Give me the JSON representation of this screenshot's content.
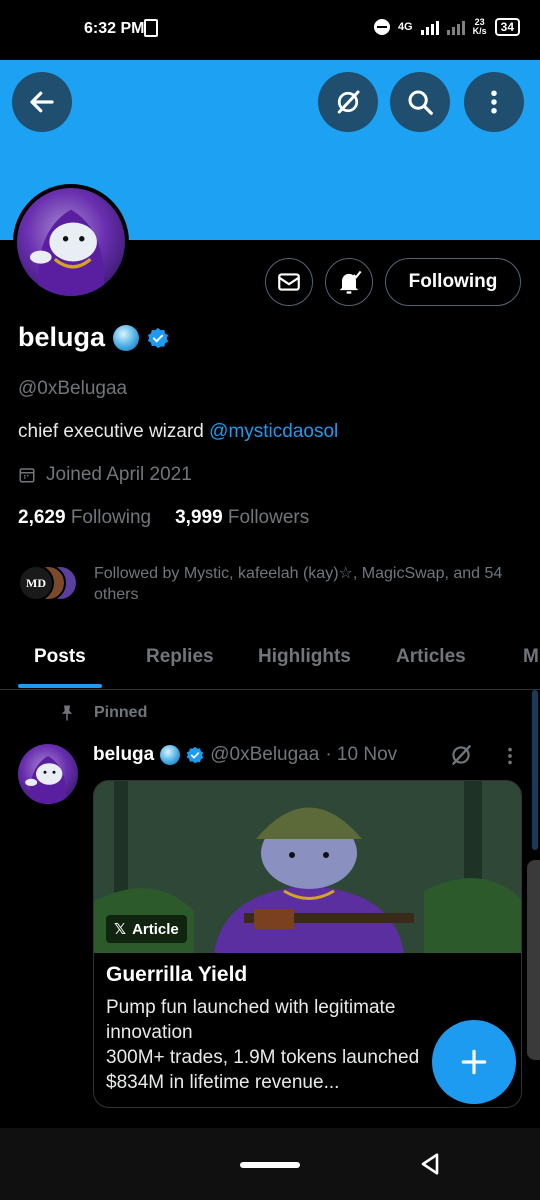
{
  "status_bar": {
    "time": "6:32 PM",
    "network": "4G",
    "speed_value": "23",
    "speed_unit": "K/s",
    "battery": "34"
  },
  "header": {
    "back_icon": "arrow-left-icon",
    "grok_icon": "grok-icon",
    "search_icon": "search-icon",
    "more_icon": "more-vertical-icon"
  },
  "profile": {
    "name": "beluga",
    "handle": "@0xBelugaa",
    "bio_text": "chief executive wizard ",
    "bio_mention": "@mysticdaosol",
    "joined": "Joined April 2021",
    "following_count": "2,629",
    "following_label": "Following",
    "followers_count": "3,999",
    "followers_label": "Followers",
    "followed_by": "Followed by Mystic, kafeelah (kay)☆, MagicSwap, and 54 others",
    "follow_button_label": "Following",
    "badge_mutual_text": "MD"
  },
  "tabs": [
    "Posts",
    "Replies",
    "Highlights",
    "Articles",
    "M"
  ],
  "active_tab": "Posts",
  "pinned_post": {
    "pinned_label": "Pinned",
    "author_name": "beluga",
    "author_handle": "@0xBelugaa",
    "date": "· 10 Nov",
    "article_badge": "Article",
    "article_title": "Guerrilla Yield",
    "article_desc_lines": [
      "Pump fun launched with legitimate",
      "innovation",
      "300M+ trades, 1.9M tokens launched",
      "$834M in lifetime revenue..."
    ]
  },
  "colors": {
    "banner": "#1da1f2",
    "accent": "#1d9bf0",
    "secondary_text": "#71767b",
    "background": "#000000"
  }
}
